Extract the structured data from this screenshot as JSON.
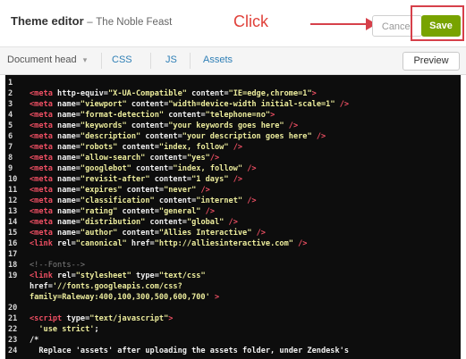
{
  "header": {
    "title": "Theme editor",
    "separator": "–",
    "subtitle": "The Noble Feast",
    "annotation": "Click",
    "cancel_label": "Cancel",
    "save_label": "Save"
  },
  "tabs": {
    "document_head": "Document head",
    "dropdown_glyph": "▾",
    "css": "CSS",
    "js": "JS",
    "assets": "Assets",
    "preview": "Preview"
  },
  "editor": {
    "lines": [
      {
        "n": "1",
        "segs": []
      },
      {
        "n": "2",
        "segs": [
          [
            "tag",
            "<meta "
          ],
          [
            "attr",
            "http-equiv="
          ],
          [
            "val",
            "\"X-UA-Compatible\""
          ],
          [
            "attr",
            " content="
          ],
          [
            "val",
            "\"IE=edge,chrome=1\""
          ],
          [
            "tag",
            ">"
          ]
        ]
      },
      {
        "n": "3",
        "segs": [
          [
            "tag",
            "<meta "
          ],
          [
            "attr",
            "name="
          ],
          [
            "val",
            "\"viewport\""
          ],
          [
            "attr",
            " content="
          ],
          [
            "val",
            "\"width=device-width initial-scale=1\""
          ],
          [
            "tag",
            " />"
          ]
        ]
      },
      {
        "n": "4",
        "segs": [
          [
            "tag",
            "<meta "
          ],
          [
            "attr",
            "name="
          ],
          [
            "val",
            "\"format-detection\""
          ],
          [
            "attr",
            " content="
          ],
          [
            "val",
            "\"telephone=no\""
          ],
          [
            "tag",
            ">"
          ]
        ]
      },
      {
        "n": "5",
        "segs": [
          [
            "tag",
            "<meta "
          ],
          [
            "attr",
            "name="
          ],
          [
            "val",
            "\"keywords\""
          ],
          [
            "attr",
            " content="
          ],
          [
            "val",
            "\"your keywords goes here\""
          ],
          [
            "tag",
            " />"
          ]
        ]
      },
      {
        "n": "6",
        "segs": [
          [
            "tag",
            "<meta "
          ],
          [
            "attr",
            "name="
          ],
          [
            "val",
            "\"description\""
          ],
          [
            "attr",
            " content="
          ],
          [
            "val",
            "\"your description goes here\""
          ],
          [
            "tag",
            " />"
          ]
        ]
      },
      {
        "n": "7",
        "segs": [
          [
            "tag",
            "<meta "
          ],
          [
            "attr",
            "name="
          ],
          [
            "val",
            "\"robots\""
          ],
          [
            "attr",
            " content="
          ],
          [
            "val",
            "\"index, follow\""
          ],
          [
            "tag",
            " />"
          ]
        ]
      },
      {
        "n": "8",
        "segs": [
          [
            "tag",
            "<meta "
          ],
          [
            "attr",
            "name="
          ],
          [
            "val",
            "\"allow-search\""
          ],
          [
            "attr",
            " content="
          ],
          [
            "val",
            "\"yes\""
          ],
          [
            "tag",
            "/>"
          ]
        ]
      },
      {
        "n": "9",
        "segs": [
          [
            "tag",
            "<meta "
          ],
          [
            "attr",
            "name="
          ],
          [
            "val",
            "\"googlebot\""
          ],
          [
            "attr",
            " content="
          ],
          [
            "val",
            "\"index, follow\""
          ],
          [
            "tag",
            " />"
          ]
        ]
      },
      {
        "n": "10",
        "segs": [
          [
            "tag",
            "<meta "
          ],
          [
            "attr",
            "name="
          ],
          [
            "val",
            "\"revisit-after\""
          ],
          [
            "attr",
            " content="
          ],
          [
            "val",
            "\"1 days\""
          ],
          [
            "tag",
            " />"
          ]
        ]
      },
      {
        "n": "11",
        "segs": [
          [
            "tag",
            "<meta "
          ],
          [
            "attr",
            "name="
          ],
          [
            "val",
            "\"expires\""
          ],
          [
            "attr",
            " content="
          ],
          [
            "val",
            "\"never\""
          ],
          [
            "tag",
            " />"
          ]
        ]
      },
      {
        "n": "12",
        "segs": [
          [
            "tag",
            "<meta "
          ],
          [
            "attr",
            "name="
          ],
          [
            "val",
            "\"classification\""
          ],
          [
            "attr",
            " content="
          ],
          [
            "val",
            "\"internet\""
          ],
          [
            "tag",
            " />"
          ]
        ]
      },
      {
        "n": "13",
        "segs": [
          [
            "tag",
            "<meta "
          ],
          [
            "attr",
            "name="
          ],
          [
            "val",
            "\"rating\""
          ],
          [
            "attr",
            " content="
          ],
          [
            "val",
            "\"general\""
          ],
          [
            "tag",
            " />"
          ]
        ]
      },
      {
        "n": "14",
        "segs": [
          [
            "tag",
            "<meta "
          ],
          [
            "attr",
            "name="
          ],
          [
            "val",
            "\"distribution\""
          ],
          [
            "attr",
            " content="
          ],
          [
            "val",
            "\"global\""
          ],
          [
            "tag",
            " />"
          ]
        ]
      },
      {
        "n": "15",
        "segs": [
          [
            "tag",
            "<meta "
          ],
          [
            "attr",
            "name="
          ],
          [
            "val",
            "\"author\""
          ],
          [
            "attr",
            " content="
          ],
          [
            "val",
            "\"Allies Interactive\""
          ],
          [
            "tag",
            " />"
          ]
        ]
      },
      {
        "n": "16",
        "segs": [
          [
            "tag",
            "<link "
          ],
          [
            "attr",
            "rel="
          ],
          [
            "val",
            "\"canonical\""
          ],
          [
            "attr",
            " href="
          ],
          [
            "val",
            "\"http://alliesinteractive.com\""
          ],
          [
            "tag",
            " />"
          ]
        ]
      },
      {
        "n": "17",
        "segs": []
      },
      {
        "n": "18",
        "segs": [
          [
            "comment",
            "<!--Fonts-->"
          ]
        ]
      },
      {
        "n": "19",
        "segs": [
          [
            "tag",
            "<link "
          ],
          [
            "attr",
            "rel="
          ],
          [
            "val",
            "\"stylesheet\""
          ],
          [
            "attr",
            " type="
          ],
          [
            "val",
            "\"text/css\""
          ]
        ]
      },
      {
        "n": "",
        "segs": [
          [
            "attr",
            "href="
          ],
          [
            "val",
            "'//fonts.googleapis.com/css?"
          ]
        ]
      },
      {
        "n": "",
        "segs": [
          [
            "val",
            "family=Raleway:400,100,300,500,600,700'"
          ],
          [
            "tag",
            " >"
          ]
        ]
      },
      {
        "n": "20",
        "segs": []
      },
      {
        "n": "21",
        "segs": [
          [
            "tag",
            "<script "
          ],
          [
            "attr",
            "type="
          ],
          [
            "val",
            "\"text/javascript\""
          ],
          [
            "tag",
            ">"
          ]
        ]
      },
      {
        "n": "22",
        "segs": [
          [
            "val",
            "  'use strict'"
          ],
          [
            "plain",
            ";"
          ]
        ]
      },
      {
        "n": "23",
        "segs": [
          [
            "plain",
            "/*"
          ]
        ]
      },
      {
        "n": "24",
        "segs": [
          [
            "plain",
            "  Replace 'assets' after uploading the assets folder, under Zendesk's"
          ]
        ]
      }
    ]
  }
}
